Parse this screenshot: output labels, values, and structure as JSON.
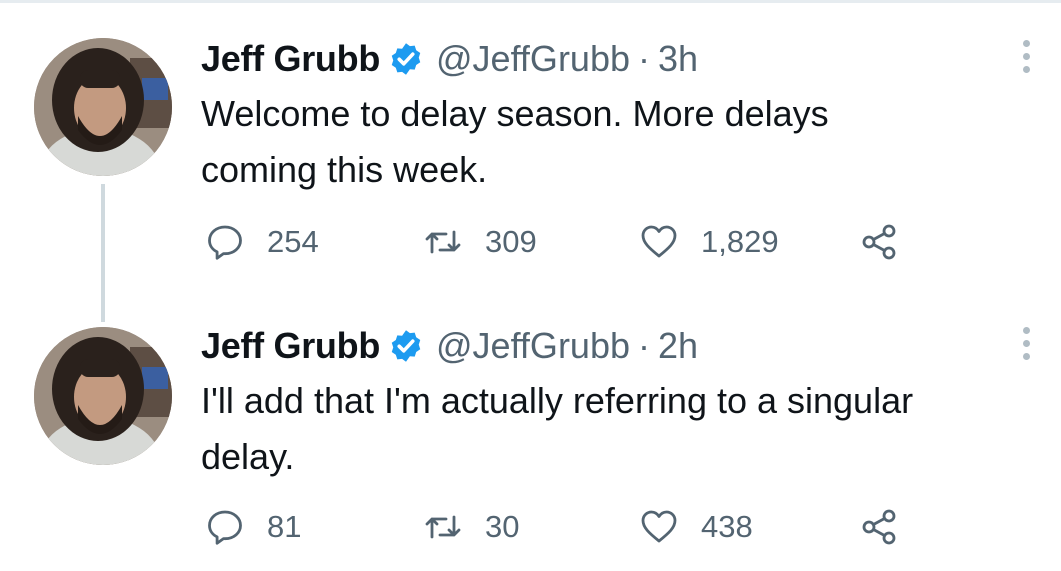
{
  "tweets": [
    {
      "name": "Jeff Grubb",
      "handle": "@JeffGrubb",
      "separator": "·",
      "time": "3h",
      "text": "Welcome to delay season. More delays\ncoming this week.",
      "replies": "254",
      "retweets": "309",
      "likes": "1,829"
    },
    {
      "name": "Jeff Grubb",
      "handle": "@JeffGrubb",
      "separator": "·",
      "time": "2h",
      "text": "I'll add that I'm actually referring to a singular\ndelay.",
      "replies": "81",
      "retweets": "30",
      "likes": "438"
    }
  ],
  "colors": {
    "verified": "#1d9bf0",
    "secondary_text": "#536471",
    "thread_line": "#cfd9de"
  },
  "icons": {
    "verified": "verified-badge-icon",
    "reply": "speech-bubble-icon",
    "retweet": "retweet-arrows-icon",
    "like": "heart-icon",
    "share": "share-icon",
    "more": "vertical-dots-icon"
  }
}
